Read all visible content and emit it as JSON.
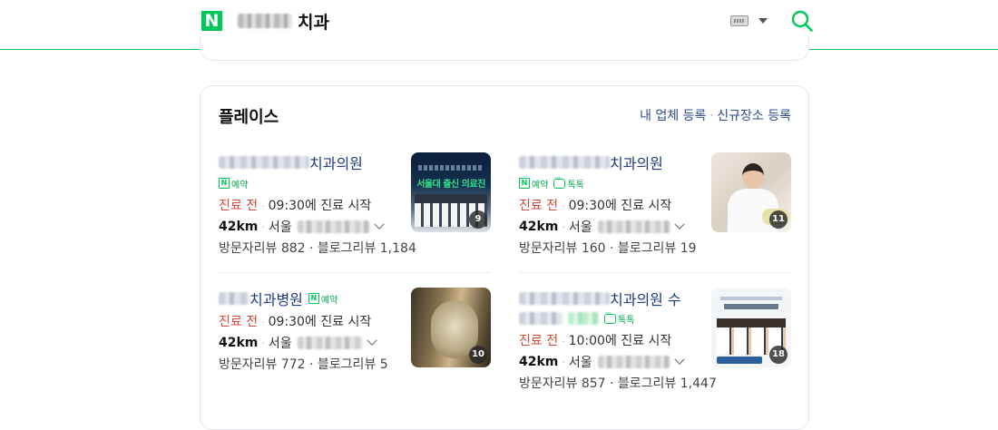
{
  "header": {
    "query_suffix": "치과"
  },
  "place": {
    "title": "플레이스",
    "link_register": "내 업체 등록",
    "link_new": "신규장소 등록",
    "items": [
      {
        "name_suffix": "치과의원",
        "badges": [
          "예약"
        ],
        "status": "진료 전",
        "hours": "09:30에 진료 시작",
        "distance": "42km",
        "city": "서울",
        "reviews": "방문자리뷰 882 · 블로그리뷰 1,184",
        "thumb_headline": "서울대 출신 의료진",
        "photo_count": "9"
      },
      {
        "name_suffix": "치과의원",
        "badges": [
          "예약",
          "톡톡"
        ],
        "status": "진료 전",
        "hours": "09:30에 진료 시작",
        "distance": "42km",
        "city": "서울",
        "reviews": "방문자리뷰 160 · 블로그리뷰 19",
        "photo_count": "11"
      },
      {
        "name_suffix": "치과병원",
        "badges": [
          "예약"
        ],
        "status": "진료 전",
        "hours": "09:30에 진료 시작",
        "distance": "42km",
        "city": "서울",
        "reviews": "방문자리뷰 772 · 블로그리뷰 5",
        "photo_count": "10"
      },
      {
        "name_suffix": "치과의원 수",
        "badges": [
          "톡톡"
        ],
        "status": "진료 전",
        "hours": "10:00에 진료 시작",
        "distance": "42km",
        "city": "서울",
        "reviews": "방문자리뷰 857 · 블로그리뷰 1,447",
        "photo_count": "18"
      }
    ]
  },
  "icons": {
    "logo": "naver-logo-icon",
    "keyboard": "keyboard-icon",
    "search": "search-icon"
  },
  "colors": {
    "brand_green": "#03c75a",
    "status_red": "#d14a3b",
    "link_blue": "#2b4d8c"
  }
}
